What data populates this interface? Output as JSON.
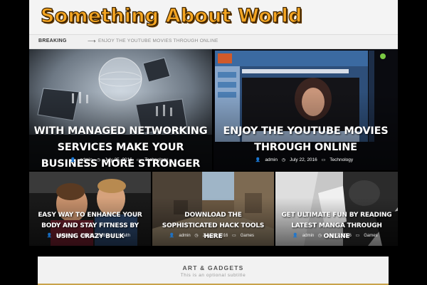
{
  "site": {
    "title": "Something About World"
  },
  "breaking": {
    "label": "BREAKING",
    "arrow": "⟶",
    "headline": "ENJOY THE YOUTUBE MOVIES THROUGH ONLINE"
  },
  "featured": [
    {
      "title": "With Managed Networking Services Make Your Business More Stronger",
      "author": "admin",
      "date": "July 25, 2016",
      "category": "Technology"
    },
    {
      "title": "Enjoy The Youtube Movies Through Online",
      "author": "admin",
      "date": "July 22, 2016",
      "category": "Technology"
    }
  ],
  "posts": [
    {
      "title": "Easy Way To Enhance Your Body And Stay Fitness By Using Crazy Bulk",
      "author": "admin",
      "date": "July 22, 2016",
      "category": "Health"
    },
    {
      "title": "Download The Sophisticated Hack Tools Here",
      "author": "admin",
      "date": "July 22, 2016",
      "category": "Games"
    },
    {
      "title": "Get Ultimate Fun By Reading Latest Manga Through Online",
      "author": "admin",
      "date": "July 22, 2016",
      "category": "Games"
    }
  ],
  "section": {
    "title": "ART & GADGETS",
    "subtitle": "This is an optional subtitle"
  },
  "icons": {
    "author": "user-icon",
    "date": "clock-icon",
    "category": "folder-icon"
  },
  "colors": {
    "title_fill": "#f5a623",
    "accent_line": "#c8a24a"
  }
}
